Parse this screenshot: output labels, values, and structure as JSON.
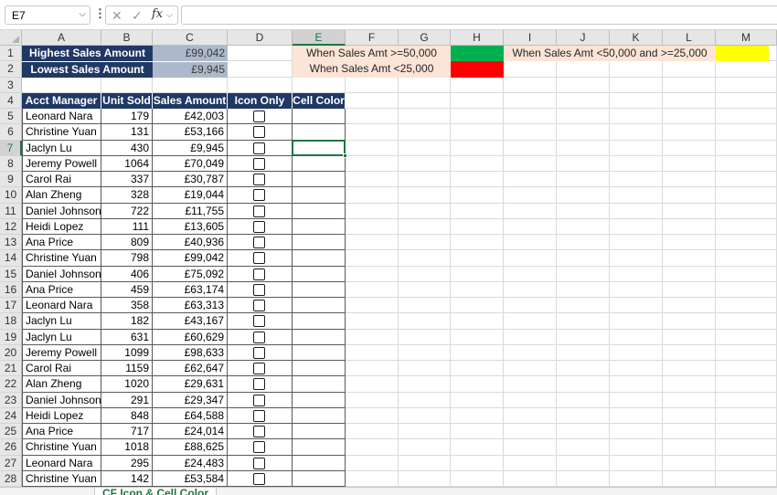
{
  "formula_bar": {
    "name_box": "E7",
    "name_box_arrow": "⌵",
    "dots": "⋮",
    "cancel_icon": "✕",
    "enter_icon": "✓",
    "fx_label": "fx",
    "fx_arrow": "⌵",
    "formula": ""
  },
  "columns": [
    "A",
    "B",
    "C",
    "D",
    "E",
    "F",
    "G",
    "H",
    "I",
    "J",
    "K",
    "L",
    "M"
  ],
  "selected_column": "E",
  "selected_row": "7",
  "row_numbers": [
    "1",
    "2",
    "3",
    "4",
    "5",
    "6",
    "7",
    "8",
    "9",
    "10",
    "11",
    "12",
    "13",
    "14",
    "15",
    "16",
    "17",
    "18",
    "19",
    "20",
    "21",
    "22",
    "23",
    "24",
    "25",
    "26",
    "27",
    "28"
  ],
  "summary": {
    "highest_label": "Highest Sales Amount",
    "highest_value": "£99,042",
    "lowest_label": "Lowest Sales Amount",
    "lowest_value": "£9,945"
  },
  "legend": {
    "rule1_text": "When Sales Amt >=50,000",
    "rule1_color": "#00b050",
    "rule2_text": "When Sales Amt <25,000",
    "rule2_color": "#ff0000",
    "rule3_text": "When Sales Amt <50,000 and >=25,000",
    "rule3_color": "#ffff00"
  },
  "table": {
    "headers": [
      "Acct Manager",
      "Unit Sold",
      "Sales Amount",
      "Icon Only",
      "Cell Color"
    ],
    "rows": [
      {
        "manager": "Leonard Nara",
        "units": "179",
        "amount": "£42,003"
      },
      {
        "manager": "Christine Yuan",
        "units": "131",
        "amount": "£53,166"
      },
      {
        "manager": "Jaclyn Lu",
        "units": "430",
        "amount": "£9,945"
      },
      {
        "manager": "Jeremy Powell",
        "units": "1064",
        "amount": "£70,049"
      },
      {
        "manager": "Carol Rai",
        "units": "337",
        "amount": "£30,787"
      },
      {
        "manager": "Alan Zheng",
        "units": "328",
        "amount": "£19,044"
      },
      {
        "manager": "Daniel Johnson",
        "units": "722",
        "amount": "£11,755"
      },
      {
        "manager": "Heidi Lopez",
        "units": "111",
        "amount": "£13,605"
      },
      {
        "manager": "Ana Price",
        "units": "809",
        "amount": "£40,936"
      },
      {
        "manager": "Christine Yuan",
        "units": "798",
        "amount": "£99,042"
      },
      {
        "manager": "Daniel Johnson",
        "units": "406",
        "amount": "£75,092"
      },
      {
        "manager": "Ana Price",
        "units": "459",
        "amount": "£63,174"
      },
      {
        "manager": "Leonard Nara",
        "units": "358",
        "amount": "£63,313"
      },
      {
        "manager": "Jaclyn Lu",
        "units": "182",
        "amount": "£43,167"
      },
      {
        "manager": "Jaclyn Lu",
        "units": "631",
        "amount": "£60,629"
      },
      {
        "manager": "Jeremy Powell",
        "units": "1099",
        "amount": "£98,633"
      },
      {
        "manager": "Carol Rai",
        "units": "1159",
        "amount": "£62,647"
      },
      {
        "manager": "Alan Zheng",
        "units": "1020",
        "amount": "£29,631"
      },
      {
        "manager": "Daniel Johnson",
        "units": "291",
        "amount": "£29,347"
      },
      {
        "manager": "Heidi Lopez",
        "units": "848",
        "amount": "£64,588"
      },
      {
        "manager": "Ana Price",
        "units": "717",
        "amount": "£24,014"
      },
      {
        "manager": "Christine Yuan",
        "units": "1018",
        "amount": "£88,625"
      },
      {
        "manager": "Leonard Nara",
        "units": "295",
        "amount": "£24,483"
      },
      {
        "manager": "Christine Yuan",
        "units": "142",
        "amount": "£53,584"
      }
    ]
  },
  "sheet_tabs": {
    "active": "CF Icon & Cell Color"
  }
}
